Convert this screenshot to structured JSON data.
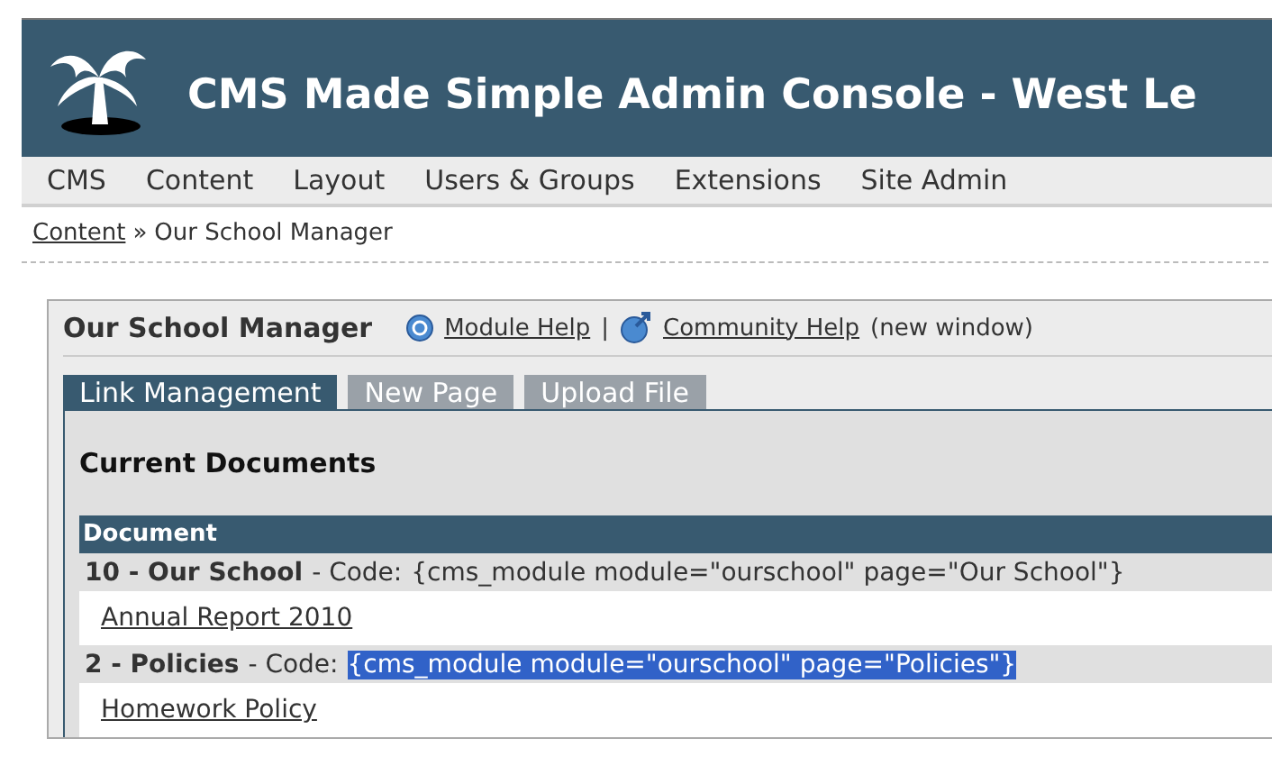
{
  "header": {
    "title": "CMS Made Simple Admin Console - West Le"
  },
  "nav": [
    {
      "label": "CMS"
    },
    {
      "label": "Content"
    },
    {
      "label": "Layout"
    },
    {
      "label": "Users & Groups"
    },
    {
      "label": "Extensions"
    },
    {
      "label": "Site Admin"
    }
  ],
  "breadcrumb": {
    "link": "Content",
    "separator": "»",
    "current": "Our School Manager"
  },
  "panel": {
    "title": "Our School Manager",
    "module_help": "Module Help",
    "divider": "|",
    "community_help": "Community Help",
    "note": "(new window)"
  },
  "tabs": [
    {
      "label": "Link Management",
      "selected": true
    },
    {
      "label": "New Page",
      "selected": false
    },
    {
      "label": "Upload File",
      "selected": false
    }
  ],
  "section_title": "Current Documents",
  "table": {
    "columns": [
      "Document"
    ],
    "rows": [
      {
        "kind": "page",
        "title": "10 - Our School",
        "code_label": "- Code:",
        "code": "{cms_module module=\"ourschool\" page=\"Our School\"}",
        "code_selected": false
      },
      {
        "kind": "document",
        "label": "Annual Report 2010"
      },
      {
        "kind": "page",
        "title": "2 - Policies",
        "code_label": "- Code:",
        "code": "{cms_module module=\"ourschool\" page=\"Policies\"}",
        "code_selected": true
      },
      {
        "kind": "document",
        "label": "Homework Policy"
      }
    ]
  }
}
